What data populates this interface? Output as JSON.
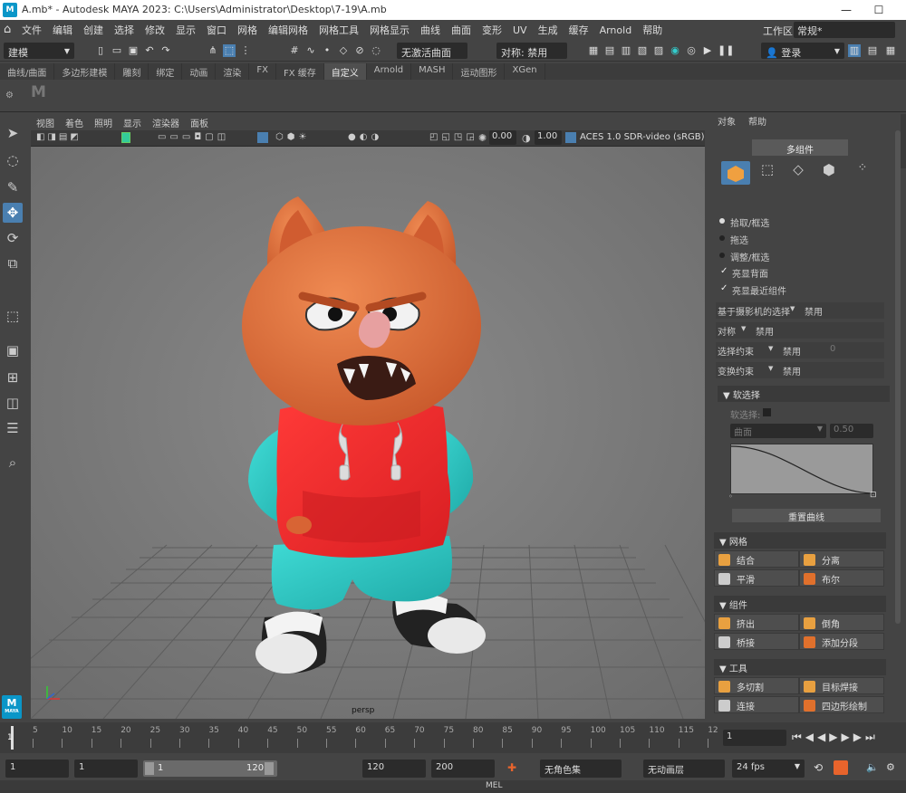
{
  "window": {
    "title": "A.mb* - Autodesk MAYA 2023: C:\\Users\\Administrator\\Desktop\\7-19\\A.mb",
    "logo_top": "M",
    "logo_sub": "MAYA"
  },
  "menu": [
    "文件",
    "编辑",
    "创建",
    "选择",
    "修改",
    "显示",
    "窗口",
    "网格",
    "编辑网格",
    "网格工具",
    "网格显示",
    "曲线",
    "曲面",
    "变形",
    "UV",
    "生成",
    "缓存",
    "Arnold",
    "帮助"
  ],
  "workspace": {
    "label": "工作区:",
    "value": "常规*"
  },
  "status": {
    "mode": "建模",
    "no_surface": "无激活曲面",
    "symmetry": "对称: 禁用",
    "login": "登录"
  },
  "shelf_tabs": [
    "曲线/曲面",
    "多边形建模",
    "雕刻",
    "绑定",
    "动画",
    "渲染",
    "FX",
    "FX 缓存",
    "自定义",
    "Arnold",
    "MASH",
    "运动图形",
    "XGen"
  ],
  "shelf_active": "自定义",
  "viewport": {
    "menu": [
      "视图",
      "着色",
      "照明",
      "显示",
      "渲染器",
      "面板"
    ],
    "val1": "0.00",
    "val2": "1.00",
    "colorspace": "ACES 1.0 SDR-video (sRGB)",
    "camera": "persp"
  },
  "panel": {
    "tabs": [
      "对象",
      "帮助"
    ],
    "header_btn": "多组件",
    "radios": [
      {
        "label": "拾取/框选",
        "on": true
      },
      {
        "label": "拖选",
        "on": false
      },
      {
        "label": "调整/框选",
        "on": false
      }
    ],
    "checks": [
      "亮显背面",
      "亮显最近组件"
    ],
    "props": [
      {
        "label": "基于摄影机的选择",
        "value": "禁用"
      },
      {
        "label": "对称",
        "value": "禁用"
      },
      {
        "label": "选择约束",
        "value": "禁用",
        "extra": "0"
      },
      {
        "label": "变换约束",
        "value": "禁用"
      }
    ],
    "soft": {
      "title": "软选择",
      "label": "软选择:",
      "falloff": "曲面",
      "value": "0.50",
      "reset": "重置曲线"
    },
    "mesh": {
      "title": "网格",
      "buttons": [
        "结合",
        "分离",
        "平滑",
        "布尔"
      ]
    },
    "component": {
      "title": "组件",
      "buttons": [
        "挤出",
        "倒角",
        "桥接",
        "添加分段"
      ]
    },
    "tools": {
      "title": "工具",
      "buttons": [
        "多切割",
        "目标焊接",
        "连接",
        "四边形绘制"
      ]
    }
  },
  "timeline": {
    "ticks": [
      "5",
      "10",
      "15",
      "20",
      "25",
      "30",
      "35",
      "40",
      "45",
      "50",
      "55",
      "60",
      "65",
      "70",
      "75",
      "80",
      "85",
      "90",
      "95",
      "100",
      "105",
      "110",
      "115",
      "12"
    ],
    "current": "1",
    "start_mark": "1"
  },
  "range": {
    "start": "1",
    "playback_start": "1",
    "slider_start": "1",
    "slider_end": "120",
    "end": "120",
    "max_end": "200",
    "char_set": "无角色集",
    "anim_layer": "无动画层",
    "fps": "24 fps"
  },
  "mel": "MEL",
  "colors": {
    "accent": "#4a7fb0",
    "shirt": "#e8262a",
    "sleeve": "#2ec8c4",
    "skin": "#e0703e"
  }
}
